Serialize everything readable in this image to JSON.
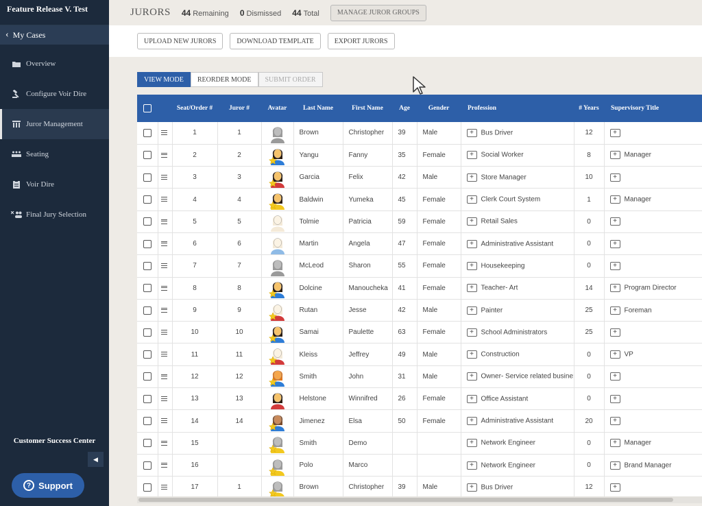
{
  "app": {
    "title": "Feature Release V. Test"
  },
  "sidebar": {
    "back_label": "My Cases",
    "items": [
      {
        "label": "Overview",
        "icon": "folder-icon"
      },
      {
        "label": "Configure Voir Dire",
        "icon": "gavel-icon"
      },
      {
        "label": "Juror Management",
        "icon": "columns-icon",
        "active": true
      },
      {
        "label": "Seating",
        "icon": "seats-icon"
      },
      {
        "label": "Voir Dire",
        "icon": "clipboard-icon"
      },
      {
        "label": "Final Jury Selection",
        "icon": "users-x-icon"
      }
    ],
    "customer_success": "Customer Success Center",
    "support_label": "Support"
  },
  "header": {
    "title": "JURORS",
    "remaining_count": "44",
    "remaining_label": "Remaining",
    "dismissed_count": "0",
    "dismissed_label": "Dismissed",
    "total_count": "44",
    "total_label": "Total",
    "manage_groups_label": "MANAGE JUROR GROUPS"
  },
  "toolbar": {
    "upload_label": "UPLOAD NEW JURORS",
    "download_label": "DOWNLOAD TEMPLATE",
    "export_label": "EXPORT JURORS"
  },
  "modes": {
    "view_label": "VIEW MODE",
    "reorder_label": "REORDER MODE",
    "submit_label": "SUBMIT ORDER"
  },
  "table": {
    "headers": {
      "seat": "Seat/Order #",
      "juror": "Juror #",
      "avatar": "Avatar",
      "last": "Last Name",
      "first": "First Name",
      "age": "Age",
      "gender": "Gender",
      "profession": "Profession",
      "years": "# Years",
      "supervisory": "Supervisory Title"
    },
    "rows": [
      {
        "seat": "1",
        "juror": "1",
        "last": "Brown",
        "first": "Christopher",
        "age": "39",
        "gender": "Male",
        "profession": "Bus Driver",
        "years": "12",
        "title": "",
        "hair": "#9a9a9a",
        "shirt": "#9a9a9a",
        "skin": "#bdbdbd",
        "star": false
      },
      {
        "seat": "2",
        "juror": "2",
        "last": "Yangu",
        "first": "Fanny",
        "age": "35",
        "gender": "Female",
        "profession": "Social Worker",
        "years": "8",
        "title": "Manager",
        "hair": "#2b1d12",
        "shirt": "#2e7dd7",
        "skin": "#f6c36b",
        "star": true
      },
      {
        "seat": "3",
        "juror": "3",
        "last": "Garcia",
        "first": "Felix",
        "age": "42",
        "gender": "Male",
        "profession": "Store Manager",
        "years": "10",
        "title": "",
        "hair": "#2b1d12",
        "shirt": "#d23b3b",
        "skin": "#f6c36b",
        "star": true
      },
      {
        "seat": "4",
        "juror": "4",
        "last": "Baldwin",
        "first": "Yumeka",
        "age": "45",
        "gender": "Female",
        "profession": "Clerk Court System",
        "years": "1",
        "title": "Manager",
        "hair": "#2b1d12",
        "shirt": "#f2c81f",
        "skin": "#f6c36b",
        "star": true
      },
      {
        "seat": "5",
        "juror": "5",
        "last": "Tolmie",
        "first": "Patricia",
        "age": "59",
        "gender": "Female",
        "profession": "Retail Sales",
        "years": "0",
        "title": "",
        "hair": "#f4ead8",
        "shirt": "#f4ead8",
        "skin": "#fbf3e4",
        "star": false
      },
      {
        "seat": "6",
        "juror": "6",
        "last": "Martin",
        "first": "Angela",
        "age": "47",
        "gender": "Female",
        "profession": "Administrative Assistant",
        "years": "0",
        "title": "",
        "hair": "#f4ead8",
        "shirt": "#8fbbe6",
        "skin": "#fbf3e4",
        "star": false
      },
      {
        "seat": "7",
        "juror": "7",
        "last": "McLeod",
        "first": "Sharon",
        "age": "55",
        "gender": "Female",
        "profession": "Housekeeping",
        "years": "0",
        "title": "",
        "hair": "#9a9a9a",
        "shirt": "#9a9a9a",
        "skin": "#bdbdbd",
        "star": false
      },
      {
        "seat": "8",
        "juror": "8",
        "last": "Dolcine",
        "first": "Manoucheka",
        "age": "41",
        "gender": "Female",
        "profession": "Teacher- Art",
        "years": "14",
        "title": "Program Director",
        "hair": "#2b1d12",
        "shirt": "#2e7dd7",
        "skin": "#f6c36b",
        "star": true
      },
      {
        "seat": "9",
        "juror": "9",
        "last": "Rutan",
        "first": "Jesse",
        "age": "42",
        "gender": "Male",
        "profession": "Painter",
        "years": "25",
        "title": "Foreman",
        "hair": "#f4ead8",
        "shirt": "#d23b3b",
        "skin": "#fbf3e4",
        "star": true
      },
      {
        "seat": "10",
        "juror": "10",
        "last": "Samai",
        "first": "Paulette",
        "age": "63",
        "gender": "Female",
        "profession": "School  Administrators",
        "years": "25",
        "title": "",
        "hair": "#2b1d12",
        "shirt": "#2e7dd7",
        "skin": "#f6c36b",
        "star": true
      },
      {
        "seat": "11",
        "juror": "11",
        "last": "Kleiss",
        "first": "Jeffrey",
        "age": "49",
        "gender": "Male",
        "profession": "Construction",
        "years": "0",
        "title": "VP",
        "hair": "#f4ead8",
        "shirt": "#d23b3b",
        "skin": "#fbf3e4",
        "star": true
      },
      {
        "seat": "12",
        "juror": "12",
        "last": "Smith",
        "first": "John",
        "age": "31",
        "gender": "Male",
        "profession": "Owner- Service related busine:",
        "years": "0",
        "title": "",
        "hair": "#e0761c",
        "shirt": "#2e7dd7",
        "skin": "#f6a64a",
        "star": true
      },
      {
        "seat": "13",
        "juror": "13",
        "last": "Helstone",
        "first": "Winnifred",
        "age": "26",
        "gender": "Female",
        "profession": "Office Assistant",
        "years": "0",
        "title": "",
        "hair": "#2b1d12",
        "shirt": "#d23b3b",
        "skin": "#f6c36b",
        "star": false
      },
      {
        "seat": "14",
        "juror": "14",
        "last": "Jimenez",
        "first": "Elsa",
        "age": "50",
        "gender": "Female",
        "profession": "Administrative Assistant",
        "years": "20",
        "title": "",
        "hair": "#7a4a2a",
        "shirt": "#2e7dd7",
        "skin": "#c98a5a",
        "star": true
      },
      {
        "seat": "15",
        "juror": "",
        "last": "Smith",
        "first": "Demo",
        "age": "",
        "gender": "",
        "profession": "Network Engineer",
        "years": "0",
        "title": "Manager",
        "hair": "#9a9a9a",
        "shirt": "#f2c81f",
        "skin": "#bdbdbd",
        "star": true
      },
      {
        "seat": "16",
        "juror": "",
        "last": "Polo",
        "first": "Marco",
        "age": "",
        "gender": "",
        "profession": "Network Engineer",
        "years": "0",
        "title": "Brand Manager",
        "hair": "#9a9a9a",
        "shirt": "#f2c81f",
        "skin": "#bdbdbd",
        "star": true
      },
      {
        "seat": "17",
        "juror": "1",
        "last": "Brown",
        "first": "Christopher",
        "age": "39",
        "gender": "Male",
        "profession": "Bus Driver",
        "years": "12",
        "title": "",
        "hair": "#9a9a9a",
        "shirt": "#f2c81f",
        "skin": "#bdbdbd",
        "star": true
      }
    ]
  }
}
